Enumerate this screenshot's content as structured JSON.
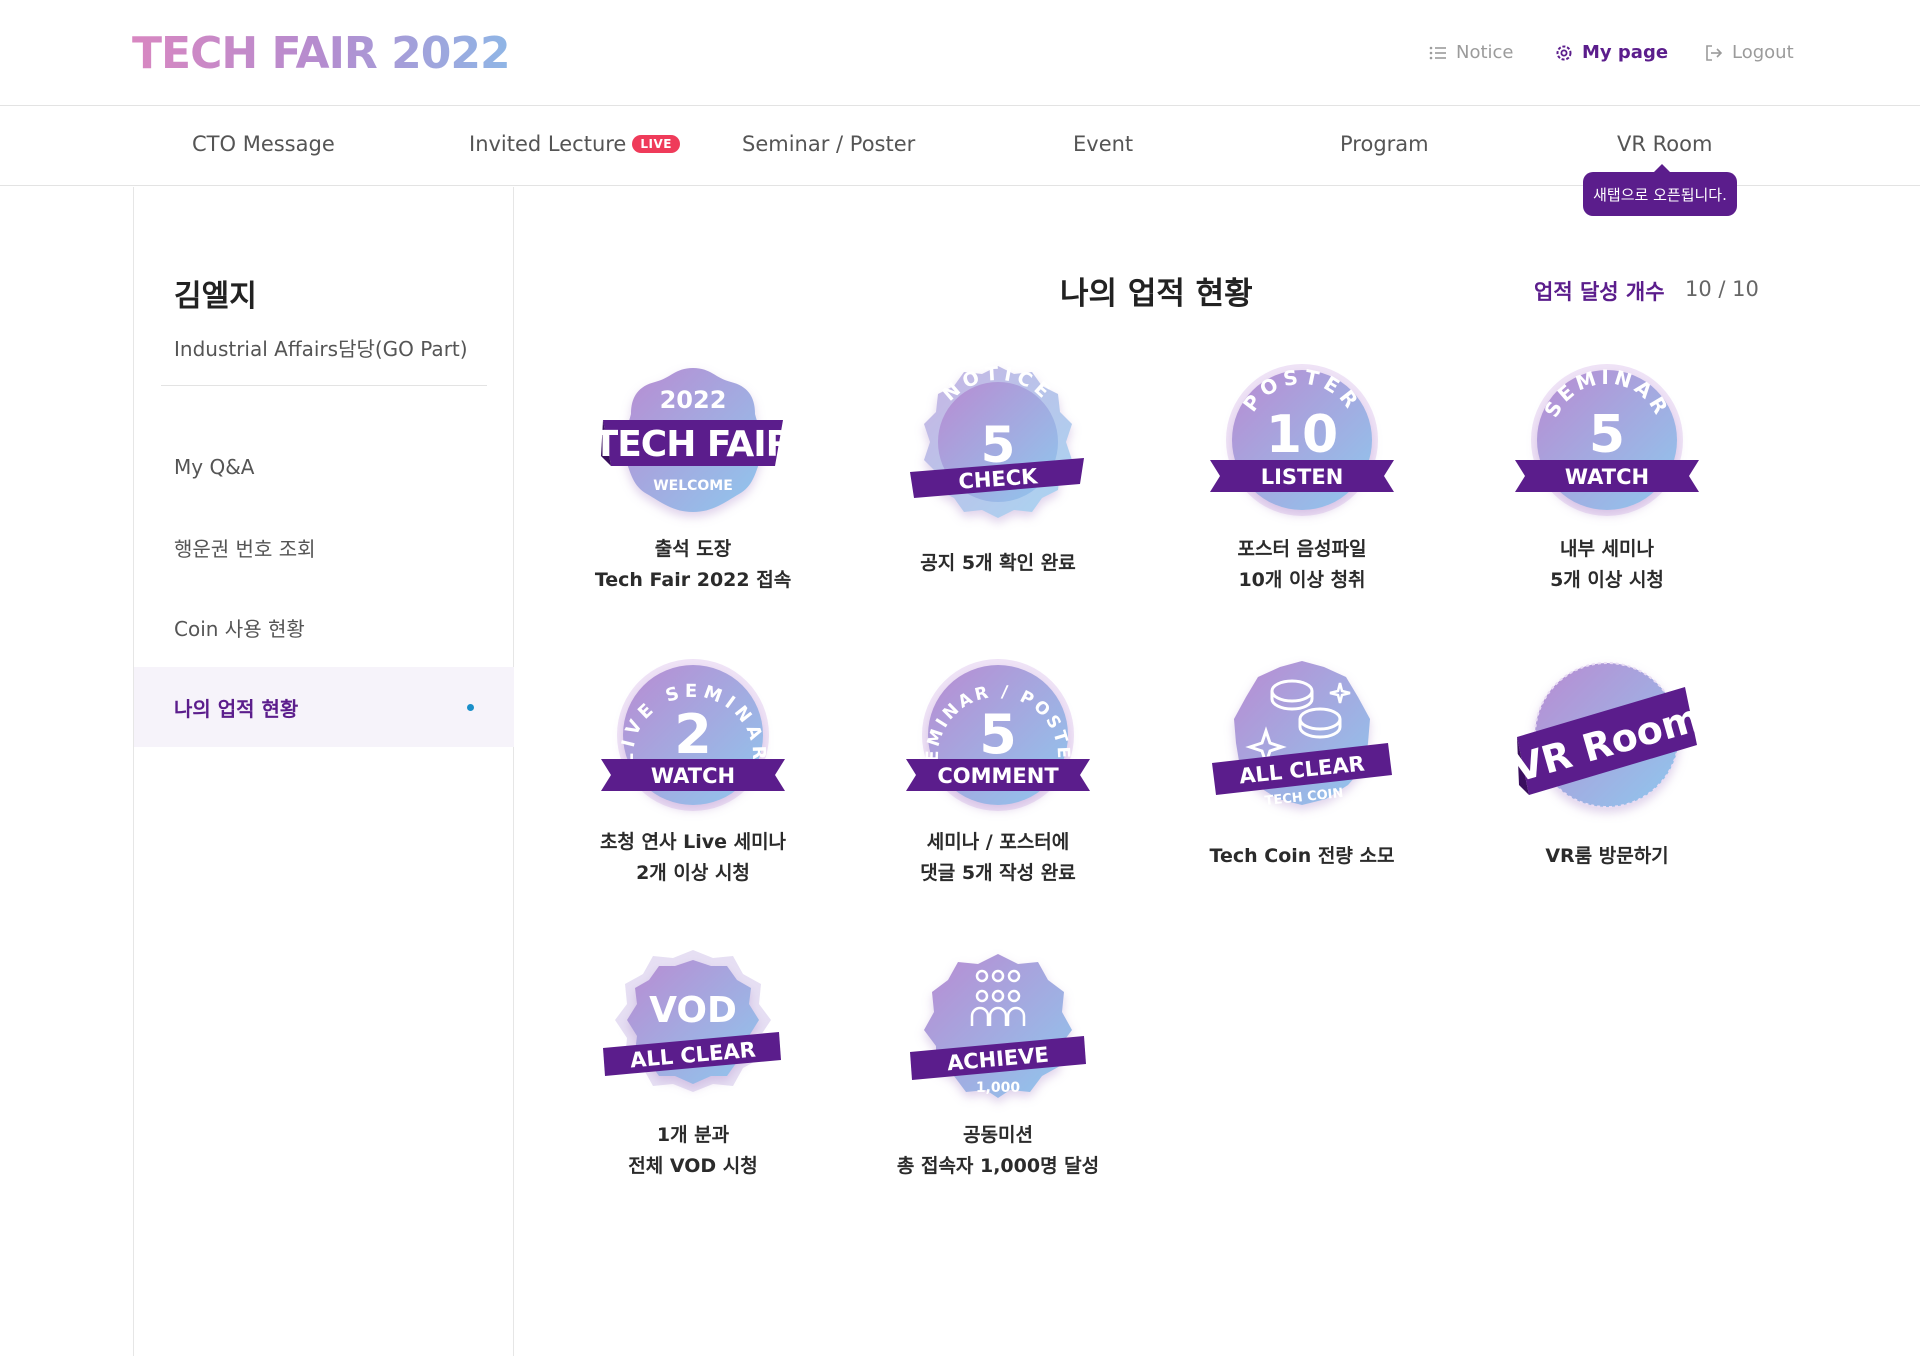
{
  "header": {
    "logo": "TECH FAIR 2022",
    "notice": "Notice",
    "mypage": "My page",
    "logout": "Logout"
  },
  "gnb": {
    "items": [
      "CTO Message",
      "Invited Lecture",
      "Seminar / Poster",
      "Event",
      "Program",
      "VR Room"
    ],
    "live_badge": "LIVE",
    "tooltip": "새탭으로 오픈됩니다."
  },
  "sidebar": {
    "name": "김엘지",
    "dept": "Industrial Affairs담당(GO Part)",
    "items": [
      "My Q&A",
      "행운권 번호 조회",
      "Coin 사용 현황",
      "나의 업적 현황"
    ]
  },
  "main": {
    "title": "나의 업적 현황",
    "count_label": "업적 달성 개수",
    "count_value": "10 / 10"
  },
  "badges": [
    {
      "top": "2022",
      "main": "TECH FAIR",
      "sub": "WELCOME",
      "cap1": "출석 도장",
      "cap2": "Tech Fair 2022 접속"
    },
    {
      "arc": "NOTICE",
      "num": "5",
      "ribbon": "CHECK",
      "cap1": "공지 5개 확인 완료",
      "cap2": ""
    },
    {
      "arc": "POSTER",
      "num": "10",
      "ribbon": "LISTEN",
      "cap1": "포스터 음성파일",
      "cap2": "10개 이상 청취"
    },
    {
      "arc": "SEMINAR",
      "num": "5",
      "ribbon": "WATCH",
      "cap1": "내부 세미나",
      "cap2": "5개 이상 시청"
    },
    {
      "arc": "LIVE SEMINAR",
      "num": "2",
      "ribbon": "WATCH",
      "cap1": "초청 연사 Live 세미나",
      "cap2": "2개 이상 시청"
    },
    {
      "arc": "SEMINAR / POSTER",
      "num": "5",
      "ribbon": "COMMENT",
      "cap1": "세미나 / 포스터에",
      "cap2": "댓글 5개 작성 완료"
    },
    {
      "ribbon": "ALL CLEAR",
      "sub": "TECH COIN",
      "cap1": "Tech Coin  전량 소모",
      "cap2": ""
    },
    {
      "ribbon": "VR Room",
      "cap1": "VR룸 방문하기",
      "cap2": ""
    },
    {
      "main": "VOD",
      "ribbon": "ALL CLEAR",
      "cap1": "1개 분과",
      "cap2": "전체 VOD 시청"
    },
    {
      "ribbon": "ACHIEVE",
      "sub": "1,000",
      "cap1": "공동미션",
      "cap2": "총 접속자 1,000명 달성"
    }
  ],
  "colors": {
    "accent": "#5b1d8c",
    "live": "#ef3b5a",
    "dot": "#1a8fc9",
    "badge_light": "#9fc6ec",
    "badge_dark": "#b487d0"
  },
  "icons": [
    "list-icon",
    "gear-icon",
    "logout-icon",
    "coin-icon",
    "people-icon",
    "sparkle-icon"
  ]
}
